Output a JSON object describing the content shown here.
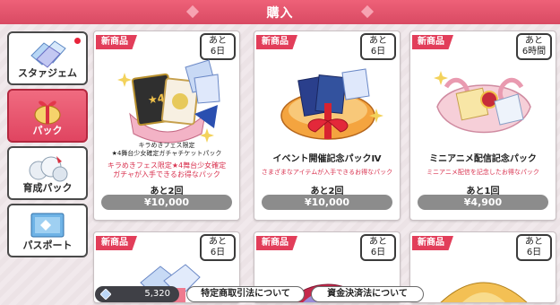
{
  "header": {
    "title": "購入"
  },
  "sidebar": {
    "items": [
      {
        "label": "スタァジェム",
        "badge": true
      },
      {
        "label": "パック",
        "active": true
      },
      {
        "label": "育成パック"
      },
      {
        "label": "パスポート"
      }
    ]
  },
  "cards": [
    {
      "tag": "新商品",
      "days_line1": "あと",
      "days_line2": "6日",
      "name_line1": "キラめきフェス限定",
      "name_line2": "★4舞台少女確定ガチャチケットパック",
      "desc_line1": "キラめきフェス限定★4舞台少女確定",
      "desc_line2": "ガチャが入手できるお得なパック",
      "remaining": "あと2回",
      "price": "¥10,000"
    },
    {
      "tag": "新商品",
      "days_line1": "あと",
      "days_line2": "6日",
      "name": "イベント開催記念パックⅣ",
      "desc": "さまざまなアイテムが入手できるお得なパック",
      "remaining": "あと2回",
      "price": "¥10,000"
    },
    {
      "tag": "新商品",
      "days_line1": "あと",
      "days_line2": "6時間",
      "name": "ミニアニメ配信記念パック",
      "desc": "ミニアニメ配信を記念したお得なパック",
      "remaining": "あと1回",
      "price": "¥4,900"
    },
    {
      "tag": "新商品",
      "days_line1": "あと",
      "days_line2": "6日"
    },
    {
      "tag": "新商品",
      "days_line1": "あと",
      "days_line2": "6日"
    },
    {
      "tag": "新商品",
      "days_line1": "あと",
      "days_line2": "6日"
    }
  ],
  "footer": {
    "currency": "5,320",
    "legal_button": "特定商取引法について",
    "funds_button": "資金決済法について"
  },
  "colors": {
    "accent": "#e23e5a",
    "header": "#e05570",
    "price_pill": "#8c8c8c"
  }
}
